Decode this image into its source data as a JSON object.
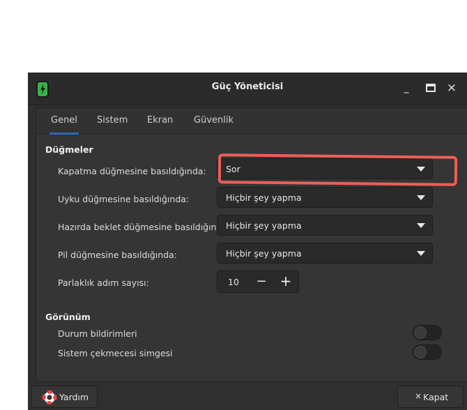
{
  "window": {
    "title": "Güç Yöneticisi"
  },
  "window_controls": {
    "minimize": "_",
    "maximize": "□",
    "close": "×"
  },
  "tabs": [
    {
      "label": "Genel",
      "active": true
    },
    {
      "label": "Sistem",
      "active": false
    },
    {
      "label": "Ekran",
      "active": false
    },
    {
      "label": "Güvenlik",
      "active": false
    }
  ],
  "buttons_section": {
    "title": "Düğmeler",
    "rows": [
      {
        "label": "Kapatma düğmesine basıldığında:",
        "value": "Sor"
      },
      {
        "label": "Uyku düğmesine basıldığında:",
        "value": "Hiçbir şey yapma"
      },
      {
        "label": "Hazırda beklet düğmesine basıldığında:",
        "value": "Hiçbir şey yapma"
      },
      {
        "label": "Pil düğmesine basıldığında:",
        "value": "Hiçbir şey yapma"
      }
    ],
    "brightness": {
      "label": "Parlaklık adım sayısı:",
      "value": "10",
      "minus": "−",
      "plus": "+"
    }
  },
  "appearance_section": {
    "title": "Görünüm",
    "toggles": [
      {
        "label": "Durum bildirimleri",
        "on": false
      },
      {
        "label": "Sistem çekmecesi simgesi",
        "on": false
      }
    ]
  },
  "footer": {
    "help_label": "Yardım",
    "close_label": "Kapat",
    "close_glyph": "×"
  },
  "colors": {
    "accent": "#2e69b6",
    "highlight": "#ee5f55",
    "battery": "#36b34a"
  }
}
